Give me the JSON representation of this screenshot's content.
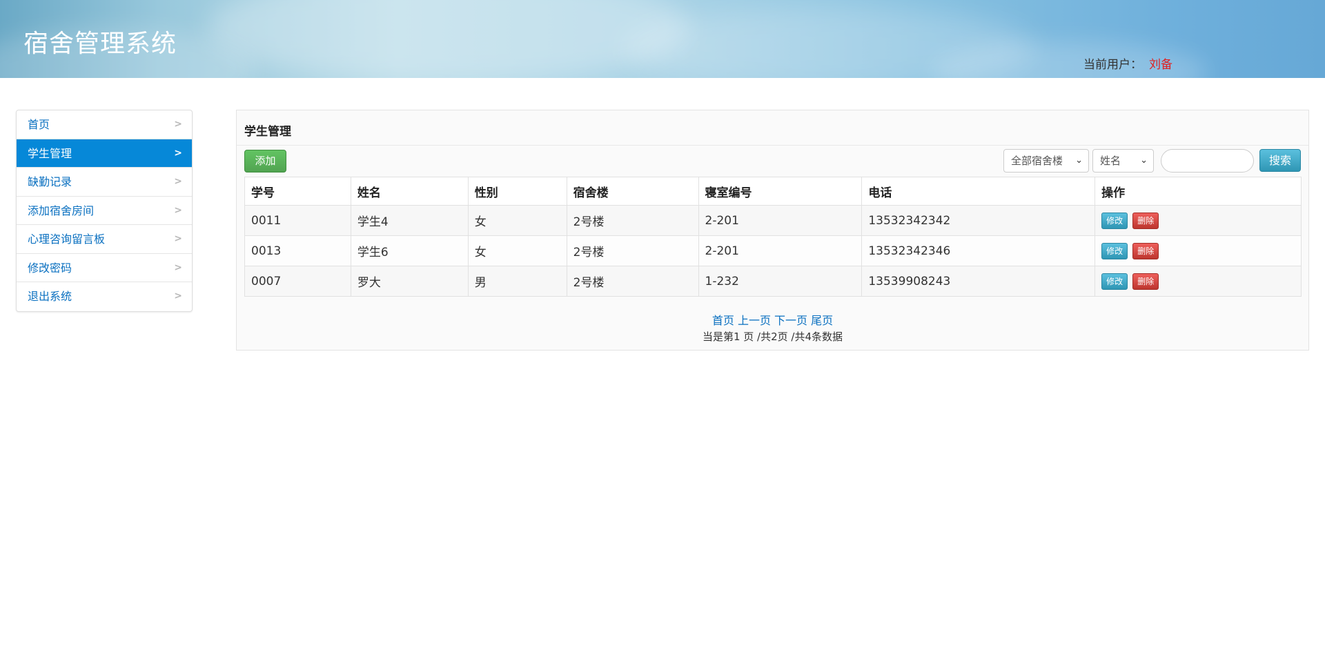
{
  "header": {
    "app_title": "宿舍管理系统",
    "user_label": "当前用户：",
    "user_name": "刘备"
  },
  "sidebar": {
    "items": [
      {
        "label": "首页",
        "active": false
      },
      {
        "label": "学生管理",
        "active": true
      },
      {
        "label": "缺勤记录",
        "active": false
      },
      {
        "label": "添加宿舍房间",
        "active": false
      },
      {
        "label": "心理咨询留言板",
        "active": false
      },
      {
        "label": "修改密码",
        "active": false
      },
      {
        "label": "退出系统",
        "active": false
      }
    ]
  },
  "main": {
    "title": "学生管理",
    "add_label": "添加",
    "building_select": "全部宿舍楼",
    "field_select": "姓名",
    "search_value": "",
    "search_label": "搜索",
    "columns": [
      "学号",
      "姓名",
      "性别",
      "宿舍楼",
      "寝室编号",
      "电话",
      "操作"
    ],
    "rows": [
      {
        "id": "0011",
        "name": "学生4",
        "gender": "女",
        "building": "2号楼",
        "room": "2-201",
        "phone": "13532342342"
      },
      {
        "id": "0013",
        "name": "学生6",
        "gender": "女",
        "building": "2号楼",
        "room": "2-201",
        "phone": "13532342346"
      },
      {
        "id": "0007",
        "name": "罗大",
        "gender": "男",
        "building": "2号楼",
        "room": "1-232",
        "phone": "13539908243"
      }
    ],
    "edit_label": "修改",
    "delete_label": "删除",
    "pager": {
      "first": "首页",
      "prev": "上一页",
      "next": "下一页",
      "last": "尾页",
      "info": "当是第1 页 /共2页  /共4条数据"
    }
  },
  "colors": {
    "sidebar_active": "#0688d8",
    "link": "#0a70c0",
    "user_name": "#e02020",
    "add_button": "#51a351",
    "search_button": "#2f96b4",
    "delete_button": "#bd362f"
  }
}
